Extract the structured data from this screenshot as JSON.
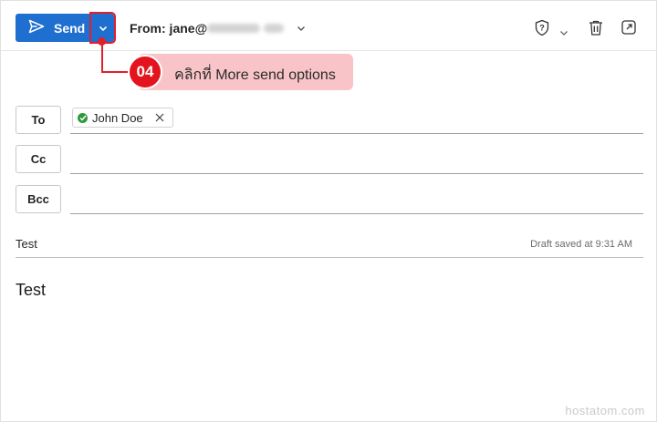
{
  "toolbar": {
    "send_label": "Send",
    "more_send_options_icon": "chevron-down-icon",
    "from_label": "From: jane@",
    "from_domain_blurred": "",
    "accent_color": "#1f6fd0"
  },
  "annotation": {
    "step_number": "04",
    "text": "คลิกที่ More send options",
    "color": "#e0202a"
  },
  "recipients": {
    "to_label": "To",
    "cc_label": "Cc",
    "bcc_label": "Bcc",
    "to_chips": [
      {
        "name": "John Doe",
        "status": "verified"
      }
    ]
  },
  "subject": {
    "value": "Test",
    "draft_status": "Draft saved at 9:31 AM"
  },
  "body": {
    "text": "Test"
  },
  "watermark": "hostatom.com"
}
